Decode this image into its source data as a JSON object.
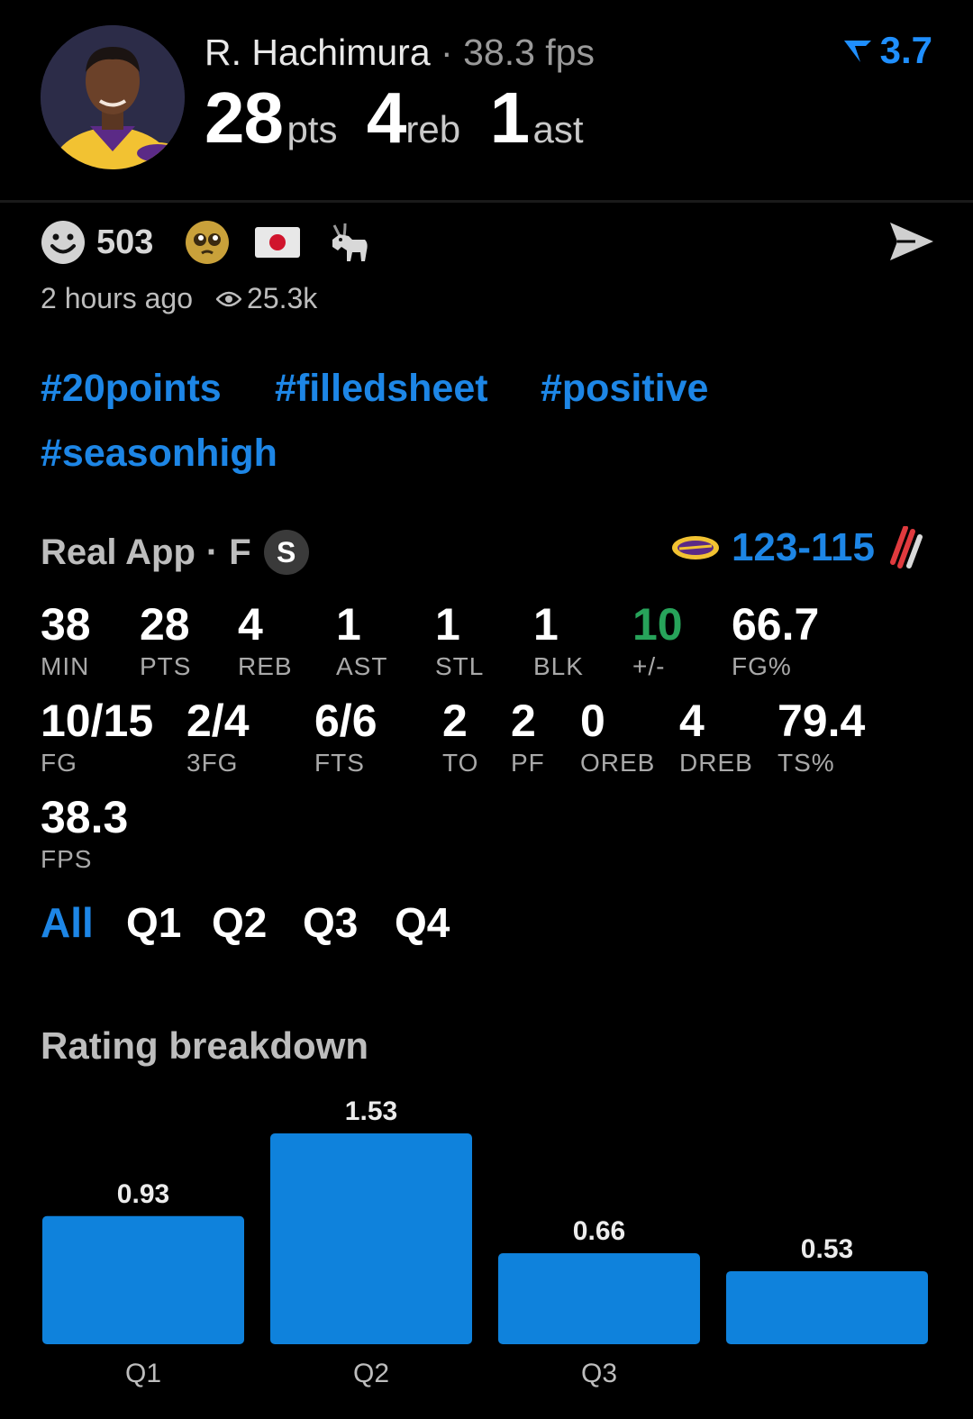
{
  "header": {
    "player_name": "R. Hachimura",
    "separator": "·",
    "fps": "38.3 fps",
    "pts": "28",
    "pts_unit": "pts",
    "reb": "4",
    "reb_unit": "reb",
    "ast": "1",
    "ast_unit": "ast",
    "rating": "3.7",
    "rating_color": "#1f8fff"
  },
  "reactions": {
    "count": "503",
    "icons": [
      "smile-icon",
      "pleading-face-icon",
      "japan-flag-icon",
      "goat-icon"
    ],
    "time": "2 hours ago",
    "views": "25.3k"
  },
  "tags": [
    "#20points",
    "#filledsheet",
    "#positive",
    "#seasonhigh"
  ],
  "game": {
    "source": "Real App",
    "sep": "·",
    "status": "F",
    "badge": "S",
    "score": "123-115"
  },
  "stats_row1": [
    {
      "value": "38",
      "label": "MIN"
    },
    {
      "value": "28",
      "label": "PTS"
    },
    {
      "value": "4",
      "label": "REB"
    },
    {
      "value": "1",
      "label": "AST"
    },
    {
      "value": "1",
      "label": "STL"
    },
    {
      "value": "1",
      "label": "BLK"
    },
    {
      "value": "10",
      "label": "+/-"
    },
    {
      "value": "66.7",
      "label": "FG%"
    }
  ],
  "stats_row2": [
    {
      "value": "10/15",
      "label": "FG"
    },
    {
      "value": "2/4",
      "label": "3FG"
    },
    {
      "value": "6/6",
      "label": "FTS"
    },
    {
      "value": "2",
      "label": "TO"
    },
    {
      "value": "2",
      "label": "PF"
    },
    {
      "value": "0",
      "label": "OREB"
    },
    {
      "value": "4",
      "label": "DREB"
    },
    {
      "value": "79.4",
      "label": "TS%"
    }
  ],
  "stats_row3": [
    {
      "value": "38.3",
      "label": "FPS"
    }
  ],
  "periods": [
    "All",
    "Q1",
    "Q2",
    "Q3",
    "Q4"
  ],
  "active_period": "All",
  "chart_title": "Rating breakdown",
  "chart_data": {
    "type": "bar",
    "title": "Rating breakdown",
    "categories": [
      "Q1",
      "Q2",
      "Q3",
      ""
    ],
    "values": [
      0.93,
      1.53,
      0.66,
      0.53
    ],
    "bar_color": "#0f82dc",
    "ylim": [
      0,
      1.53
    ]
  }
}
